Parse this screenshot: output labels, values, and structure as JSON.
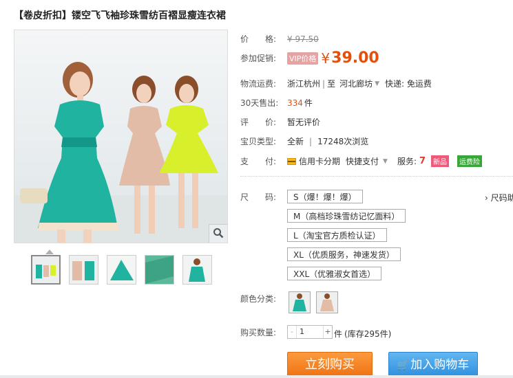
{
  "title": "【卷皮折扣】镂空飞飞袖珍珠雪纺百褶显瘦连衣裙",
  "price": {
    "label": "价　　格:",
    "original": "¥ 97.50",
    "promo_label": "参加促销:",
    "vip_badge": "VIP价格",
    "yen": "¥",
    "current": "39.00"
  },
  "shipping": {
    "label": "物流运费:",
    "from": "浙江杭州",
    "to_label": "至",
    "to": "河北廊坊",
    "fee": "快递: 免运费"
  },
  "sales": {
    "label": "30天售出:",
    "count": "334",
    "unit": "件"
  },
  "rating": {
    "label": "评　　价:",
    "value": "暂无评价"
  },
  "type": {
    "label": "宝贝类型:",
    "condition": "全新",
    "views": "17248次浏览"
  },
  "payment": {
    "label": "支　　付:",
    "credit": "信用卡分期",
    "quick": "快捷支付",
    "service_label": "服务:",
    "tag_new": "新品",
    "tag_insurance": "运费险"
  },
  "size": {
    "label": "尺　　码:",
    "options": [
      "S（爆！爆！爆）",
      "M（高档珍珠雪纺记忆面料）",
      "L（淘宝官方质检认证）",
      "XL（优质服务，神速发货）",
      "XXL（优雅淑女首选）"
    ],
    "chart_link": "尺码助"
  },
  "color": {
    "label": "颜色分类:"
  },
  "quantity": {
    "label": "购买数量:",
    "value": "1",
    "minus": "-",
    "plus": "+",
    "unit": "件",
    "stock": "(库存295件)"
  },
  "buttons": {
    "buy_now": "立刻购买",
    "add_cart": "加入购物车"
  },
  "colors": {
    "accent": "#e4500b",
    "buy": "#f07010",
    "cart": "#2d8fdd",
    "dress_teal": "#1fb3a0",
    "dress_pink": "#e3bca8",
    "dress_yellow": "#d7f02b"
  },
  "icons": [
    "zoom-icon",
    "card-icon",
    "service-icon",
    "cart-icon"
  ]
}
